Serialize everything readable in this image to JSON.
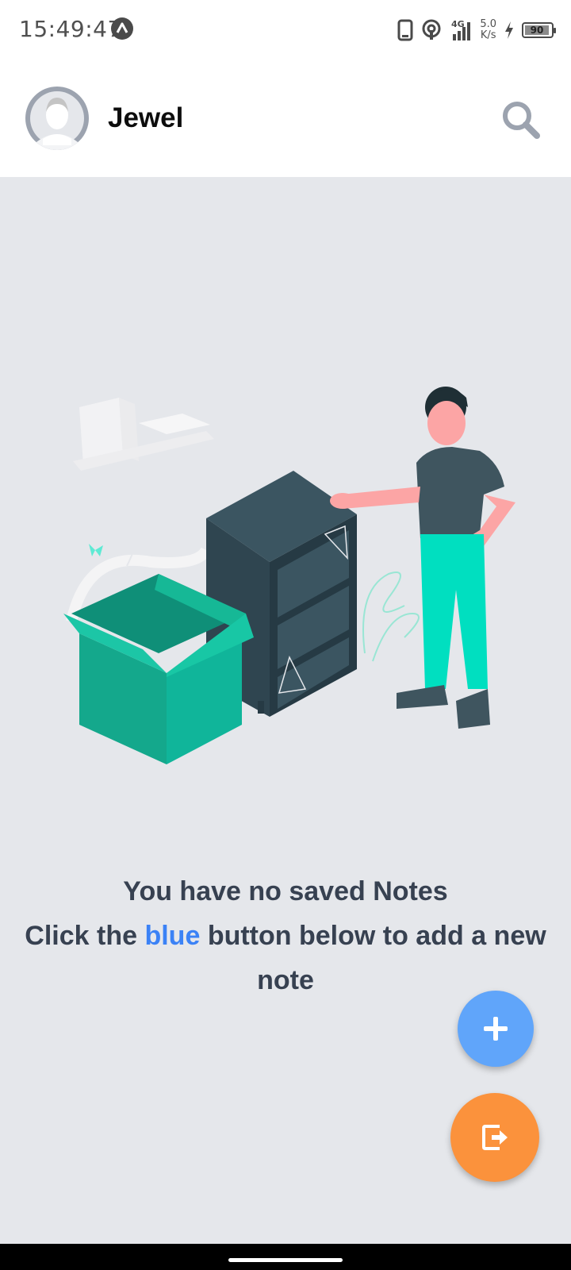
{
  "status_bar": {
    "time": "15:49:47",
    "network_type": "4G",
    "net_speed_value": "5.0",
    "net_speed_unit": "K/s",
    "battery": "90",
    "icons": [
      "app-notification-icon",
      "phone-icon",
      "hotspot-icon",
      "signal-icon",
      "charging-icon",
      "battery-icon"
    ]
  },
  "header": {
    "user_name": "Jewel",
    "icons": [
      "avatar",
      "search-icon"
    ]
  },
  "empty_state": {
    "line1": "You have no saved Notes",
    "line2_before": "Click the ",
    "line2_highlight": "blue",
    "line2_after": " button below to add a new note"
  },
  "fab": {
    "add_icon": "plus-icon",
    "logout_icon": "logout-icon"
  },
  "colors": {
    "background": "#e5e7eb",
    "text": "#374151",
    "highlight": "#3b82f6",
    "add_button": "#60a5fa",
    "logout_button": "#fb923c"
  }
}
